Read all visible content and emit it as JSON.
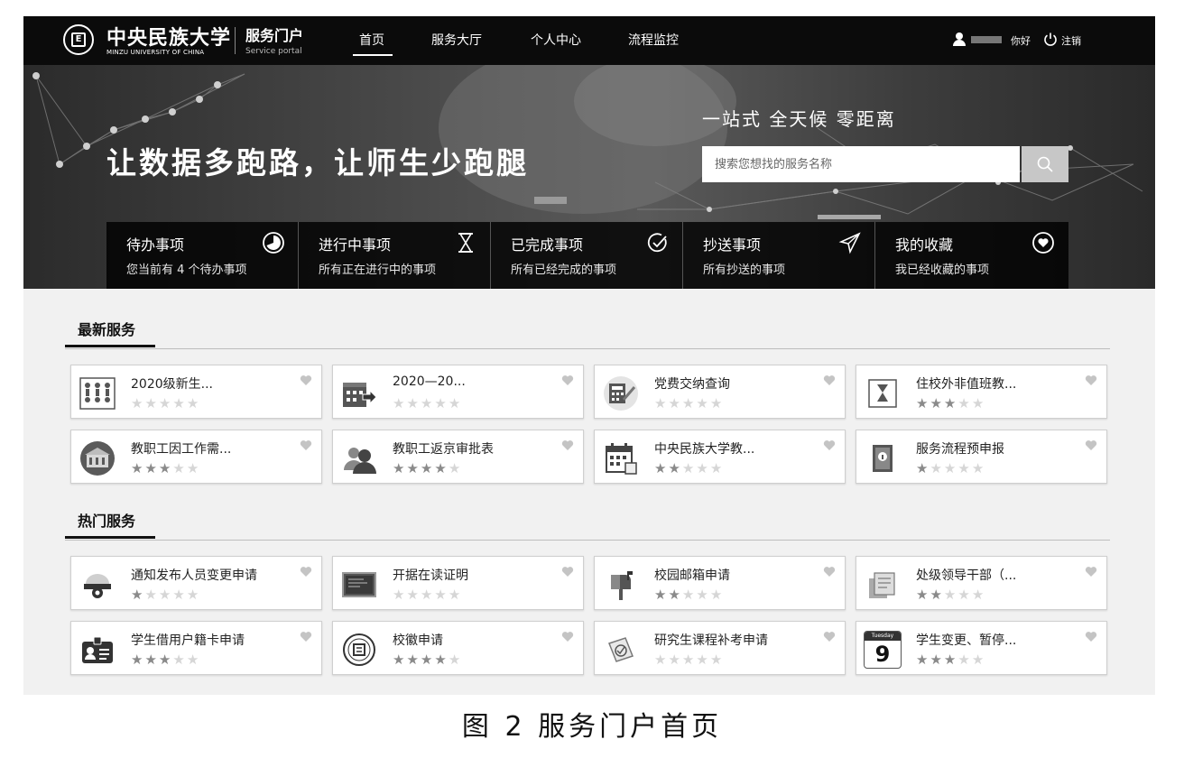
{
  "header": {
    "logo_cn": "中央民族大学",
    "logo_en": "MINZU UNIVERSITY OF CHINA",
    "portal_cn": "服务门户",
    "portal_en": "Service portal",
    "nav": [
      {
        "label": "首页",
        "active": true
      },
      {
        "label": "服务大厅",
        "active": false
      },
      {
        "label": "个人中心",
        "active": false
      },
      {
        "label": "流程监控",
        "active": false
      }
    ],
    "greeting": "你好",
    "logout": "注销"
  },
  "hero": {
    "slogan": "让数据多跑路，让师生少跑腿",
    "subtitle": "一站式  全天候  零距离",
    "search_placeholder": "搜索您想找的服务名称"
  },
  "quick_links": [
    {
      "title": "待办事项",
      "desc": "您当前有 4 个待办事项",
      "icon": "pie-clock-icon"
    },
    {
      "title": "进行中事项",
      "desc": "所有正在进行中的事项",
      "icon": "hourglass-icon"
    },
    {
      "title": "已完成事项",
      "desc": "所有已经完成的事项",
      "icon": "check-circle-icon"
    },
    {
      "title": "抄送事项",
      "desc": "所有抄送的事项",
      "icon": "paper-plane-icon"
    },
    {
      "title": "我的收藏",
      "desc": "我已经收藏的事项",
      "icon": "heart-circle-icon"
    }
  ],
  "sections": [
    {
      "title": "最新服务",
      "cards": [
        {
          "name": "2020级新生...",
          "rating": 0,
          "icon": "people-grid-icon"
        },
        {
          "name": "2020—20...",
          "rating": 0,
          "icon": "building-arrow-icon"
        },
        {
          "name": "党费交纳查询",
          "rating": 0,
          "icon": "calculator-icon"
        },
        {
          "name": "住校外非值班教...",
          "rating": 3,
          "icon": "hourglass-box-icon"
        },
        {
          "name": "教职工因工作需...",
          "rating": 3,
          "icon": "campus-building-icon"
        },
        {
          "name": "教职工返京审批表",
          "rating": 4,
          "icon": "users-icon"
        },
        {
          "name": "中央民族大学教...",
          "rating": 2,
          "icon": "calendar-icon"
        },
        {
          "name": "服务流程预申报",
          "rating": 1,
          "icon": "info-book-icon"
        }
      ]
    },
    {
      "title": "热门服务",
      "cards": [
        {
          "name": "通知发布人员变更申请",
          "rating": 1,
          "icon": "camera-dome-icon"
        },
        {
          "name": "开据在读证明",
          "rating": 0,
          "icon": "blackboard-icon"
        },
        {
          "name": "校园邮箱申请",
          "rating": 2,
          "icon": "mailbox-icon"
        },
        {
          "name": "处级领导干部（...",
          "rating": 2,
          "icon": "documents-icon"
        },
        {
          "name": "学生借用户籍卡申请",
          "rating": 3,
          "icon": "id-badge-icon"
        },
        {
          "name": "校徽申请",
          "rating": 4,
          "icon": "school-badge-icon"
        },
        {
          "name": "研究生课程补考申请",
          "rating": 0,
          "icon": "certificate-icon"
        },
        {
          "name": "学生变更、暂停...",
          "rating": 3,
          "icon": "tuesday-calendar-icon"
        }
      ]
    }
  ],
  "calendar_icon_text": {
    "day": "Tuesday",
    "date": "9"
  },
  "caption": "图 2  服务门户首页"
}
